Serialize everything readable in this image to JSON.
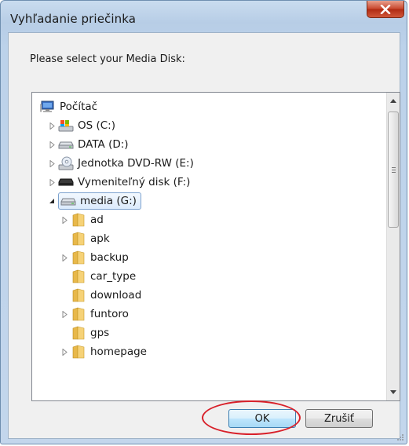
{
  "window": {
    "title": "Vyhľadanie priečinka"
  },
  "dialog": {
    "prompt": "Please select your Media Disk:"
  },
  "tree": {
    "items": [
      {
        "label": "Počítač",
        "icon": "computer-icon"
      },
      {
        "label": "OS (C:)",
        "icon": "os-drive-icon"
      },
      {
        "label": "DATA (D:)",
        "icon": "hard-drive-icon"
      },
      {
        "label": "Jednotka DVD-RW (E:)",
        "icon": "dvd-drive-icon"
      },
      {
        "label": "Vymeniteľný disk (F:)",
        "icon": "removable-disk-icon"
      },
      {
        "label": "media (G:)",
        "icon": "hard-drive-icon",
        "selected": true
      },
      {
        "label": "ad",
        "icon": "folder-icon"
      },
      {
        "label": "apk",
        "icon": "folder-icon"
      },
      {
        "label": "backup",
        "icon": "folder-icon"
      },
      {
        "label": "car_type",
        "icon": "folder-icon"
      },
      {
        "label": "download",
        "icon": "folder-icon"
      },
      {
        "label": "funtoro",
        "icon": "folder-icon"
      },
      {
        "label": "gps",
        "icon": "folder-icon"
      },
      {
        "label": "homepage",
        "icon": "folder-icon"
      }
    ]
  },
  "buttons": {
    "ok": "OK",
    "cancel": "Zrušiť"
  },
  "colors": {
    "highlight_circle": "#d8202a",
    "selection_border": "#7da2ce"
  }
}
